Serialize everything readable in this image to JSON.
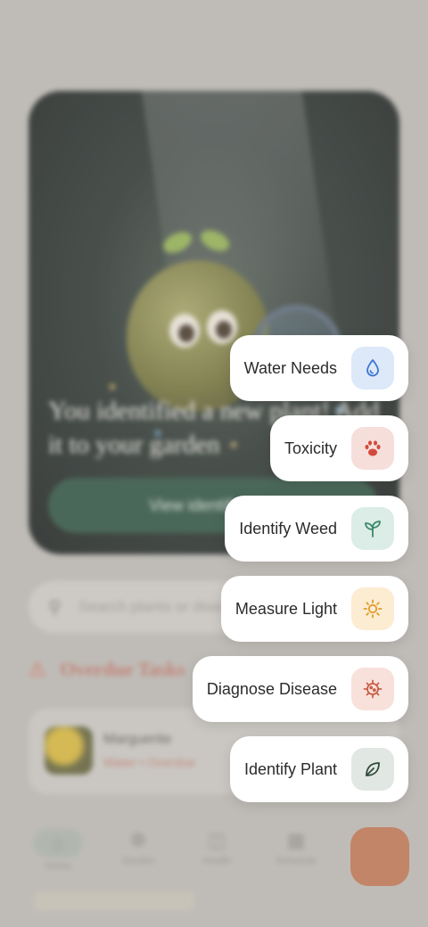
{
  "hero": {
    "title": "You identified a new plant! Add it to your garden",
    "button_label": "View identification"
  },
  "search": {
    "placeholder": "Search plants or diseases"
  },
  "overdue": {
    "title": "Overdue Tasks",
    "task_name": "Marguerite",
    "task_status": "Water • Overdue"
  },
  "tabs": [
    {
      "label": "Home",
      "icon": "home-icon"
    },
    {
      "label": "Garden",
      "icon": "leaf-icon"
    },
    {
      "label": "Health",
      "icon": "health-icon"
    },
    {
      "label": "Schedule",
      "icon": "calendar-icon"
    }
  ],
  "actions": [
    {
      "label": "Water Needs",
      "icon": "water-drop-icon",
      "bg": "#dde8f8",
      "color": "#3a78d4"
    },
    {
      "label": "Toxicity",
      "icon": "paw-icon",
      "bg": "#f6dedb",
      "color": "#d34a3c"
    },
    {
      "label": "Identify Weed",
      "icon": "sprout-icon",
      "bg": "#dcece6",
      "color": "#3a8a6a"
    },
    {
      "label": "Measure Light",
      "icon": "sun-icon",
      "bg": "#fbecd2",
      "color": "#e29a28"
    },
    {
      "label": "Diagnose Disease",
      "icon": "virus-icon",
      "bg": "#f8e1da",
      "color": "#c8604a"
    },
    {
      "label": "Identify Plant",
      "icon": "leaf-icon",
      "bg": "#e1e7e3",
      "color": "#2f4a3c"
    }
  ]
}
